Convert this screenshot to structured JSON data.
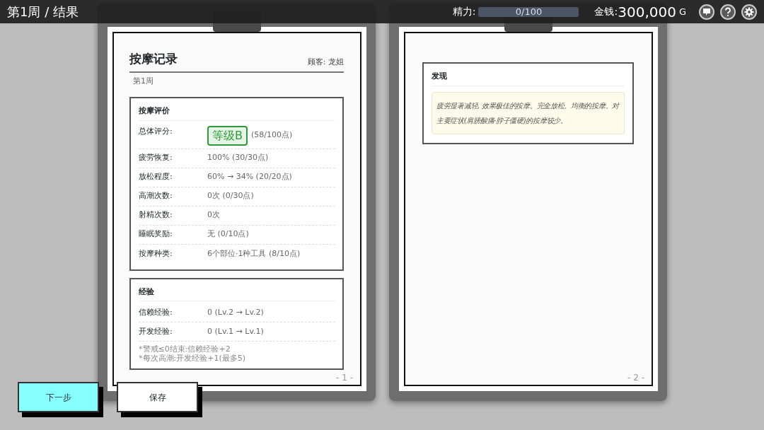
{
  "header": {
    "title": "第1周 / 结果",
    "energy": {
      "label": "精力:",
      "reading": "0/100",
      "level": 0
    },
    "money": {
      "label": "金钱:",
      "amount": "300,000",
      "unit": "G"
    }
  },
  "page_1": {
    "title": "按摩记录",
    "customer": "顾客: 龙姐",
    "week": "第1周",
    "evaluation": {
      "heading": "按摩评价",
      "rows": [
        {
          "kind": "grade",
          "label": "总体评分:",
          "badge": "等级B",
          "value": "(58/100点)"
        },
        {
          "kind": "text",
          "label": "疲劳恢复:",
          "value": "100% (30/30点)"
        },
        {
          "kind": "text",
          "label": "放松程度:",
          "value": "60% → 34% (20/20点)"
        },
        {
          "kind": "text",
          "label": "高潮次数:",
          "value": "0次 (0/30点)"
        },
        {
          "kind": "text",
          "label": "射精次数:",
          "value": "0次"
        },
        {
          "kind": "text",
          "label": "睡眠奖励:",
          "value": "无 (0/10点)"
        },
        {
          "kind": "text",
          "label": "按摩种类:",
          "value": "6个部位·1种工具 (8/10点)"
        }
      ]
    },
    "experience": {
      "heading": "经验",
      "rows": [
        {
          "label": "信赖经验:",
          "value": "0 (Lv.2 → Lv.2)"
        },
        {
          "label": "开发经验:",
          "value": "0 (Lv.1 → Lv.1)"
        }
      ],
      "notes": [
        "*警戒≤0结束:信赖经验+2",
        "*每次高潮:开发经验+1(最多5)"
      ]
    },
    "page_number": "- 1 -"
  },
  "page_2": {
    "findings": {
      "heading": "发现",
      "text": "疲劳显著减轻, 效果极佳的按摩。完全放松。均衡的按摩。对主要症状(肩膀酸痛·脖子僵硬)的按摩较少。"
    },
    "page_number": "- 2 -"
  },
  "buttons": [
    {
      "label": "下一步",
      "kind": "primary"
    },
    {
      "label": "保存",
      "kind": "default"
    }
  ]
}
